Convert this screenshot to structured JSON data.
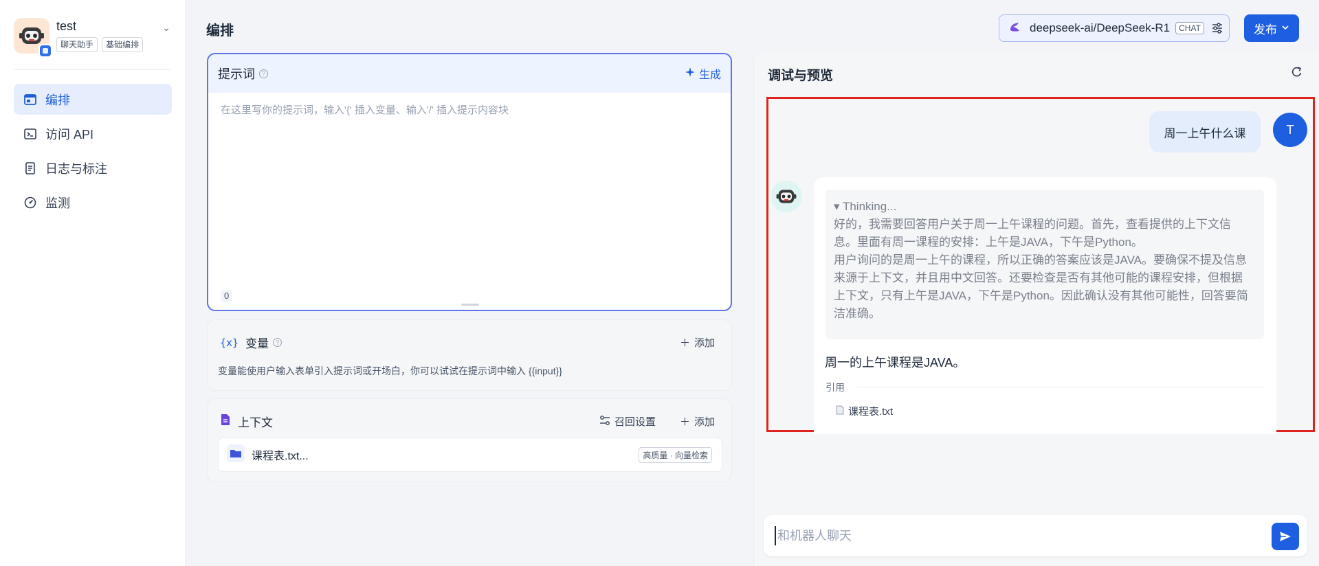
{
  "app": {
    "name": "test",
    "tags": [
      "聊天助手",
      "基础编排"
    ]
  },
  "nav": {
    "items": [
      {
        "label": "编排",
        "icon": "layout-icon",
        "active": true
      },
      {
        "label": "访问 API",
        "icon": "terminal-icon",
        "active": false
      },
      {
        "label": "日志与标注",
        "icon": "log-icon",
        "active": false
      },
      {
        "label": "监测",
        "icon": "gauge-icon",
        "active": false
      }
    ]
  },
  "header": {
    "title": "编排",
    "model_name": "deepseek-ai/DeepSeek-R1",
    "model_tag": "CHAT",
    "publish_label": "发布"
  },
  "prompt": {
    "title": "提示词",
    "generate_label": "生成",
    "placeholder": "在这里写你的提示词，输入'{' 插入变量、输入'/' 插入提示内容块",
    "char_count": "0"
  },
  "variables": {
    "icon": "{x}",
    "title": "变量",
    "add_label": "添加",
    "description": "变量能使用户输入表单引入提示词或开场白，你可以试试在提示词中输入 {{input}}"
  },
  "context": {
    "title": "上下文",
    "recall_label": "召回设置",
    "add_label": "添加",
    "file_name": "课程表.txt...",
    "file_badge": "高质量 · 向量检索"
  },
  "debug": {
    "title": "调试与预览",
    "user_initial": "T",
    "user_message": "周一上午什么课",
    "thinking_head": "▾ Thinking...",
    "thinking_p1": "好的，我需要回答用户关于周一上午课程的问题。首先，查看提供的上下文信息。里面有周一课程的安排：上午是JAVA，下午是Python。",
    "thinking_p2": "用户询问的是周一上午的课程，所以正确的答案应该是JAVA。要确保不提及信息来源于上下文，并且用中文回答。还要检查是否有其他可能的课程安排，但根据上下文，只有上午是JAVA，下午是Python。因此确认没有其他可能性，回答要简洁准确。",
    "answer": "周一的上午课程是JAVA。",
    "cite_label": "引用",
    "cite_file": "课程表.txt",
    "input_placeholder": "和机器人聊天"
  },
  "colors": {
    "accent": "#1d5fe0",
    "active_nav_bg": "#e6eefd",
    "highlight_border": "#e0231d"
  }
}
